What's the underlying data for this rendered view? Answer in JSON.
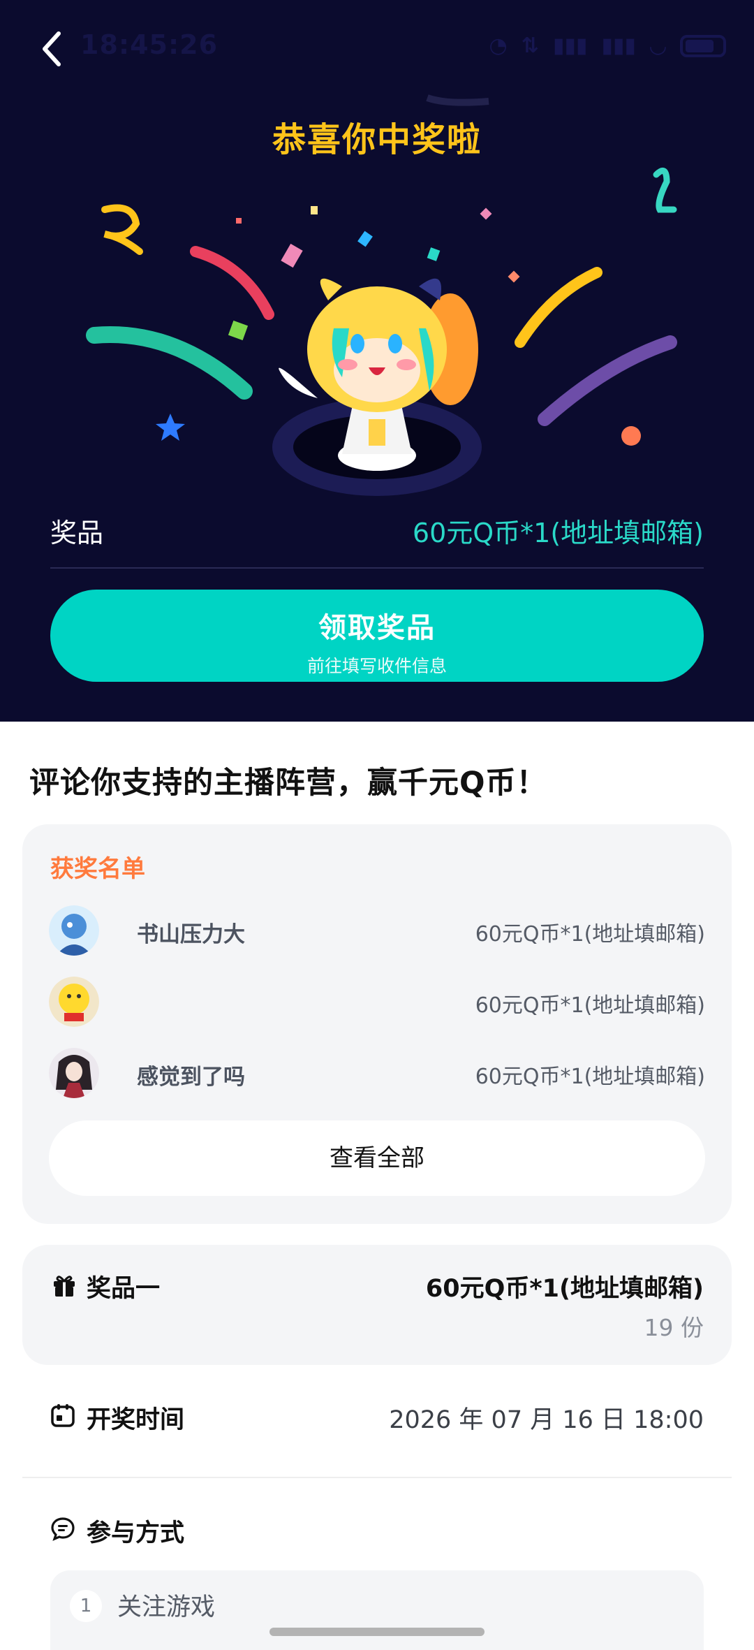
{
  "status_bar": {
    "time": "18:45:26",
    "battery": "62",
    "icons": [
      "mute-icon",
      "data-icon",
      "signal-icon",
      "signal-icon",
      "wifi-icon",
      "battery-icon"
    ]
  },
  "hero": {
    "title": "恭喜你中奖啦",
    "prize_label": "奖品",
    "prize_value": "60元Q币*1(地址填邮箱)",
    "claim_button": "领取奖品",
    "claim_sub": "前往填写收件信息"
  },
  "headline": "评论你支持的主播阵营，赢千元Q币！",
  "winners": {
    "title": "获奖名单",
    "items": [
      {
        "name": "书山压力大",
        "prize": "60元Q币*1(地址填邮箱)"
      },
      {
        "name": "",
        "prize": "60元Q币*1(地址填邮箱)"
      },
      {
        "name": "感觉到了吗",
        "prize": "60元Q币*1(地址填邮箱)"
      }
    ],
    "view_all": "查看全部"
  },
  "prize_info": {
    "label": "奖品一",
    "value": "60元Q币*1(地址填邮箱)",
    "count": "19 份"
  },
  "draw_time": {
    "label": "开奖时间",
    "value": "2026 年 07 月 16 日 18:00"
  },
  "participation": {
    "label": "参与方式",
    "steps": [
      {
        "num": "1",
        "text": "关注游戏"
      }
    ]
  },
  "colors": {
    "hero_bg": "#0b0b2e",
    "accent": "#00d4c4",
    "title_yellow": "#ffc41a",
    "winner_title": "#ff7a3d"
  }
}
